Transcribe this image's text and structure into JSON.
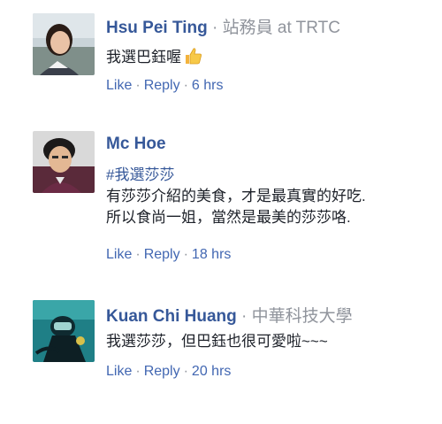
{
  "comments": [
    {
      "name": "Hsu Pei Ting",
      "affiliation": "站務員 at TRTC",
      "text": "我選巴鈺喔",
      "emoji": "thumbs-up-icon",
      "actions": {
        "like": "Like",
        "reply": "Reply",
        "time": "6 hrs"
      }
    },
    {
      "name": "Mc Hoe",
      "hashtag": "#我選莎莎",
      "lines": [
        "有莎莎介紹的美食，才是最真實的好吃.",
        "所以食尚一姐，當然是最美的莎莎咯."
      ],
      "actions": {
        "like": "Like",
        "reply": "Reply",
        "time": "18 hrs"
      }
    },
    {
      "name": "Kuan Chi Huang",
      "affiliation": "中華科技大學",
      "text": "我選莎莎，但巴鈺也很可愛啦~~~",
      "actions": {
        "like": "Like",
        "reply": "Reply",
        "time": "20 hrs"
      }
    }
  ],
  "separator": " · ",
  "action_dot": "·",
  "colors": {
    "name": "#365899",
    "link": "#4267b2",
    "muted": "#90949c",
    "text": "#1d2129"
  }
}
